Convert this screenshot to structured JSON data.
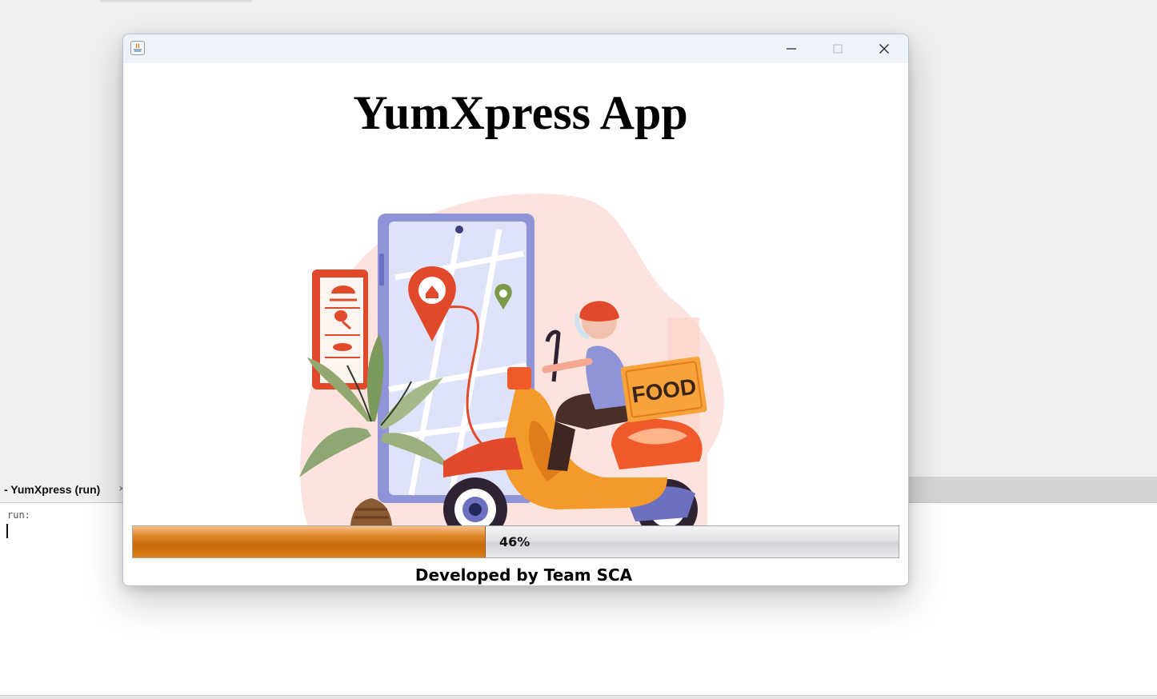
{
  "ide": {
    "output_tab_label": "- YumXpress (run)",
    "output_tab_close": "×",
    "output_text": "run:"
  },
  "window": {
    "title": "",
    "controls": [
      "minimize-icon",
      "maximize-icon",
      "close-icon"
    ]
  },
  "splash": {
    "title": "YumXpress App",
    "illustration_sign_text": "FOOD",
    "progress": {
      "value_percent": 46,
      "label": "46%"
    },
    "footer": "Developed by Team SCA"
  },
  "colors": {
    "progress_fill": "#d97c18",
    "scooter": "#f39a2a",
    "accent_red": "#e0492a",
    "phone": "#8f93d8"
  }
}
